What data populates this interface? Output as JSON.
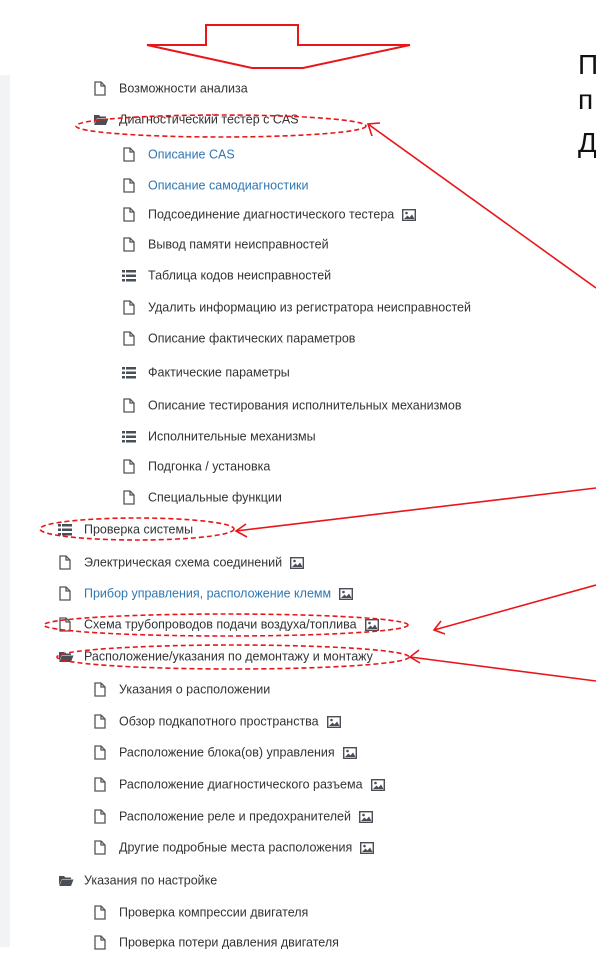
{
  "right_text_fragments": [
    "П",
    "п",
    "Д"
  ],
  "tree_items": [
    {
      "label": "Возможности анализа",
      "icon": "document-icon",
      "has_image": false
    },
    {
      "label": "Диагностический тестер с CAS",
      "icon": "folder-open-icon",
      "has_image": false
    },
    {
      "label": "Описание CAS",
      "icon": "document-icon",
      "has_image": false,
      "link": true
    },
    {
      "label": "Описание самодиагностики",
      "icon": "document-icon",
      "has_image": false,
      "link": true
    },
    {
      "label": "Подсоединение диагностического тестера",
      "icon": "document-icon",
      "has_image": true
    },
    {
      "label": "Вывод памяти неисправностей",
      "icon": "document-icon",
      "has_image": false
    },
    {
      "label": "Таблица кодов неисправностей",
      "icon": "list-icon",
      "has_image": false
    },
    {
      "label": "Удалить информацию из регистратора неисправностей",
      "icon": "document-icon",
      "has_image": false
    },
    {
      "label": "Описание фактических параметров",
      "icon": "document-icon",
      "has_image": false
    },
    {
      "label": "Фактические параметры",
      "icon": "list-icon",
      "has_image": false
    },
    {
      "label": "Описание тестирования исполнительных механизмов",
      "icon": "document-icon",
      "has_image": false
    },
    {
      "label": "Исполнительные механизмы",
      "icon": "list-icon",
      "has_image": false
    },
    {
      "label": "Подгонка / установка",
      "icon": "document-icon",
      "has_image": false
    },
    {
      "label": "Специальные функции",
      "icon": "document-icon",
      "has_image": false
    },
    {
      "label": "Проверка системы",
      "icon": "list-icon",
      "has_image": false
    },
    {
      "label": "Электрическая схема соединений",
      "icon": "document-icon",
      "has_image": true
    },
    {
      "label": "Прибор управления, расположение клемм",
      "icon": "document-icon",
      "has_image": true,
      "link": true
    },
    {
      "label": "Схема трубопроводов подачи воздуха/топлива",
      "icon": "document-icon",
      "has_image": true
    },
    {
      "label": "Расположение/указания по демонтажу и монтажу",
      "icon": "folder-open-icon",
      "has_image": false
    },
    {
      "label": "Указания о расположении",
      "icon": "document-icon",
      "has_image": false
    },
    {
      "label": "Обзор подкапотного пространства",
      "icon": "document-icon",
      "has_image": true
    },
    {
      "label": "Расположение блока(ов) управления",
      "icon": "document-icon",
      "has_image": true
    },
    {
      "label": "Расположение диагностического разъема",
      "icon": "document-icon",
      "has_image": true
    },
    {
      "label": "Расположение реле и предохранителей",
      "icon": "document-icon",
      "has_image": true
    },
    {
      "label": "Другие подробные места расположения",
      "icon": "document-icon",
      "has_image": true
    },
    {
      "label": "Указания по настройке",
      "icon": "folder-open-icon",
      "has_image": false
    },
    {
      "label": "Проверка компрессии двигателя",
      "icon": "document-icon",
      "has_image": false
    },
    {
      "label": "Проверка потери давления двигателя",
      "icon": "document-icon",
      "has_image": false
    }
  ],
  "colors": {
    "text": "#333333",
    "link": "#2f77b2",
    "annotation": "#e8161a",
    "icon": "#555555"
  }
}
